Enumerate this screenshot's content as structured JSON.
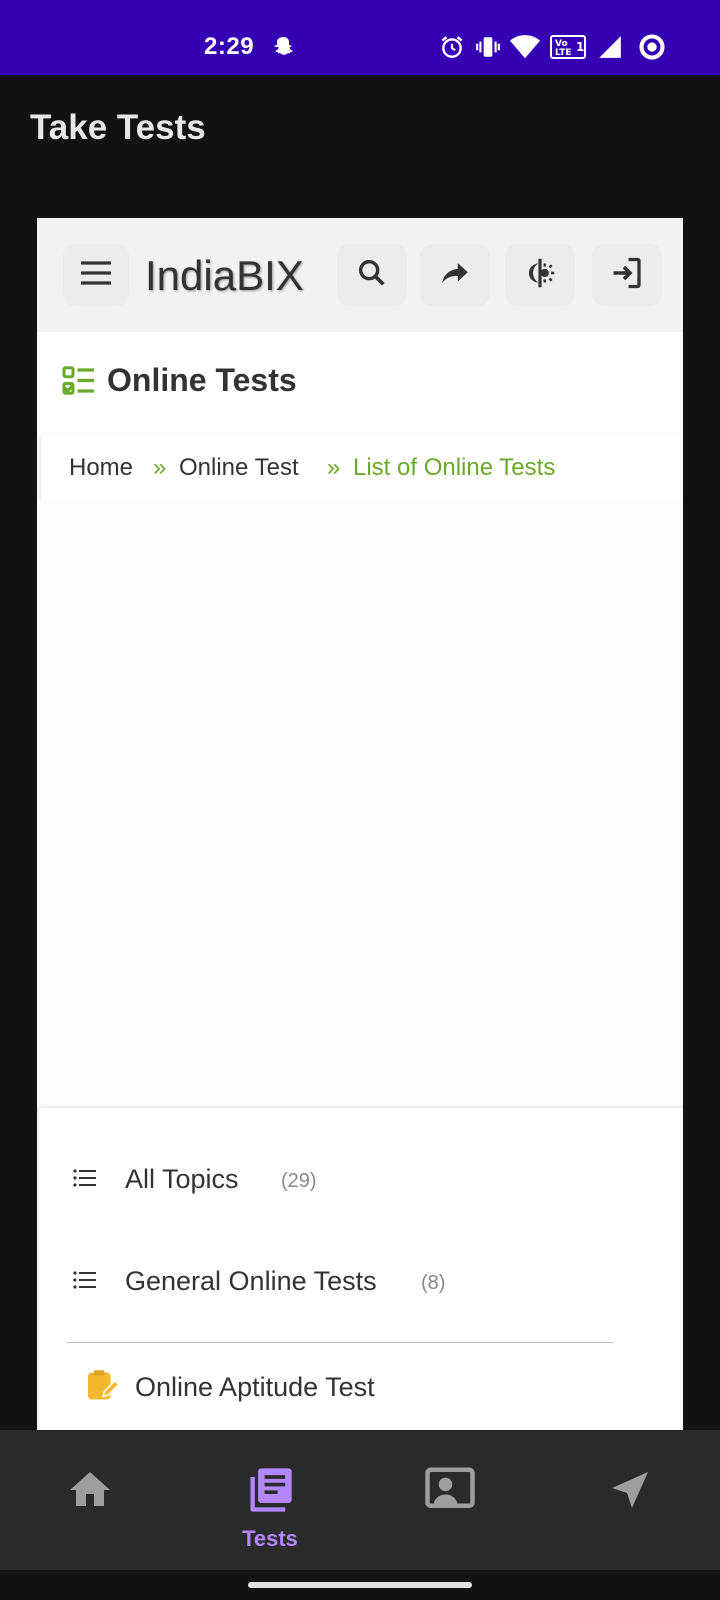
{
  "status_bar": {
    "time": "2:29",
    "icons": [
      "snapchat-icon",
      "alarm-icon",
      "vibrate-icon",
      "wifi-icon",
      "volte-icon",
      "signal-icon",
      "circle-icon"
    ],
    "volte_text": "Vo LTE 1",
    "background": "#3600b3"
  },
  "app_bar": {
    "title": "Take Tests"
  },
  "web_header": {
    "brand": "IndiaBIX",
    "icons": [
      "menu-icon",
      "search-icon",
      "share-icon",
      "theme-toggle-icon",
      "login-icon"
    ]
  },
  "page": {
    "section_title": "Online Tests",
    "section_icon": "list-check-icon",
    "accent_color": "#6aaa2a"
  },
  "breadcrumb": {
    "items": [
      "Home",
      "Online Test",
      "List of Online Tests"
    ],
    "separator": "»"
  },
  "topics": [
    {
      "label": "All Topics",
      "count": "(29)",
      "icon": "list-icon"
    },
    {
      "label": "General Online Tests",
      "count": "(8)",
      "icon": "list-icon"
    }
  ],
  "sub_items": [
    {
      "label": "Online Aptitude Test",
      "icon": "pencil-clipboard-icon"
    }
  ],
  "bottom_nav": {
    "items": [
      {
        "id": "home",
        "label": "",
        "icon": "home-icon",
        "active": false
      },
      {
        "id": "tests",
        "label": "Tests",
        "icon": "tests-icon",
        "active": true
      },
      {
        "id": "profile",
        "label": "",
        "icon": "profile-card-icon",
        "active": false
      },
      {
        "id": "send",
        "label": "",
        "icon": "send-icon",
        "active": false
      }
    ],
    "active_color": "#b388ff",
    "inactive_color": "#9e9e9e"
  }
}
